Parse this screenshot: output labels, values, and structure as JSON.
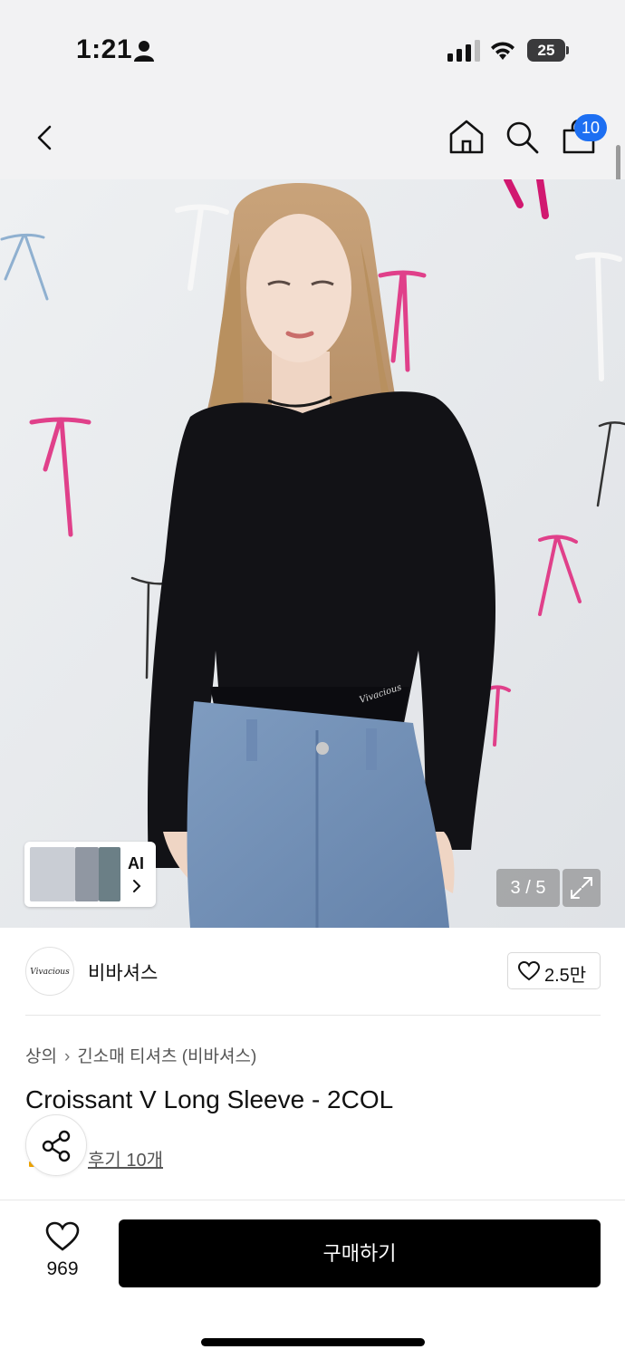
{
  "status_bar": {
    "time": "1:21",
    "battery": "25",
    "icons": [
      "person-icon",
      "signal-icon",
      "wifi-icon",
      "battery-icon"
    ]
  },
  "top_nav": {
    "icons": [
      "back-icon",
      "home-icon",
      "search-icon",
      "cart-icon"
    ],
    "cart_badge": "10"
  },
  "gallery": {
    "ai_label": "AI",
    "page_counter": "3 / 5",
    "logo_text": "Vivacious"
  },
  "brand": {
    "logo_text": "Vivacious",
    "name": "비바셔스",
    "like_count": "2.5만"
  },
  "breadcrumb": {
    "category": "상의",
    "subcategory": "긴소매 티셔츠 (비바셔스)"
  },
  "product": {
    "title": "Croissant V Long Sleeve - 2COL",
    "reviews": "후기 10개"
  },
  "bottom_bar": {
    "wish_count": "969",
    "buy_label": "구매하기"
  },
  "colors": {
    "accent_badge": "#1d6ff2",
    "buy_button": "#000000",
    "background_top": "#f2f2f3"
  }
}
